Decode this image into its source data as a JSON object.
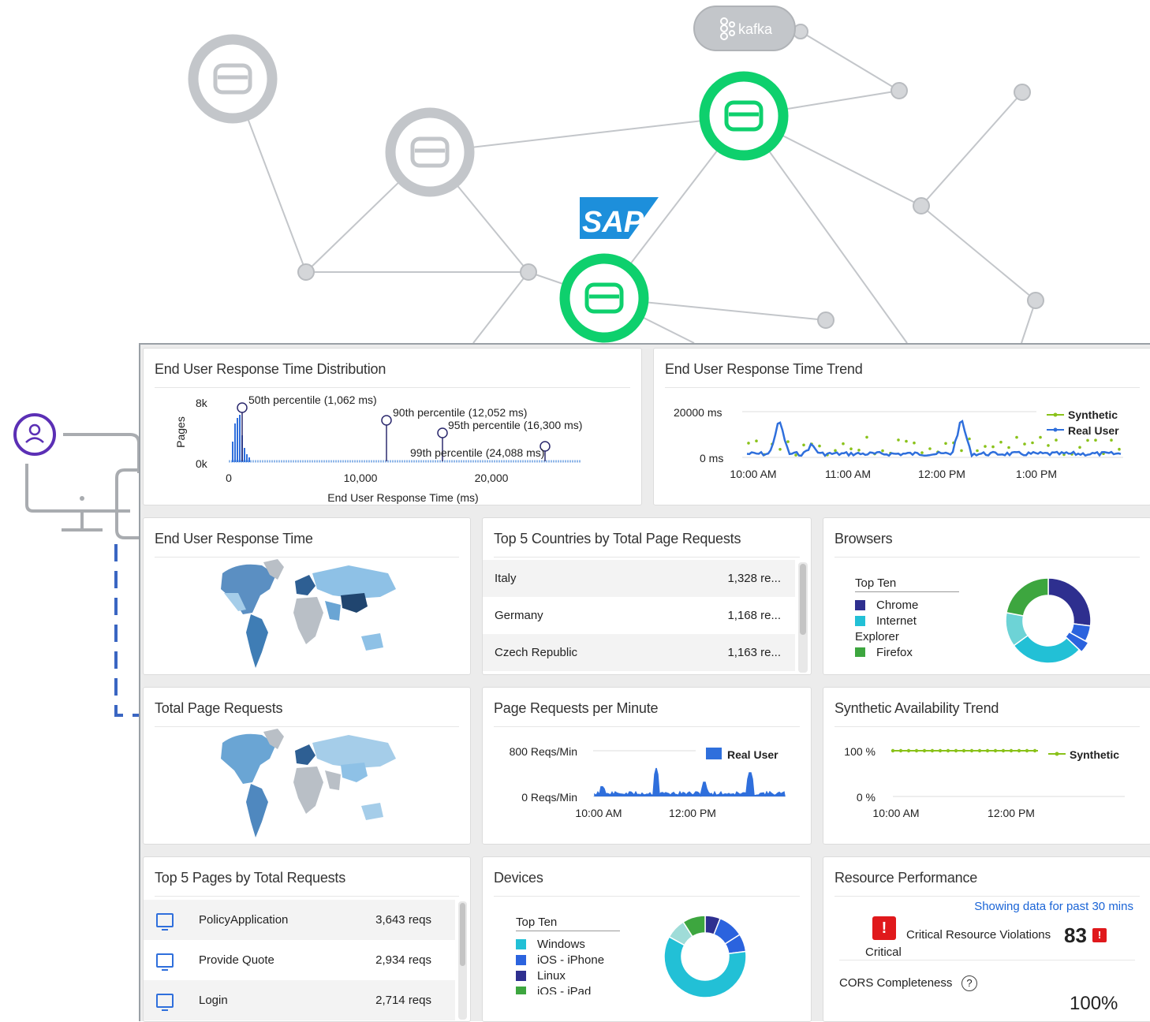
{
  "topology": {
    "kafka_label": "kafka",
    "sap_label": "SAP"
  },
  "panels": {
    "dist": {
      "title": "End User Response Time Distribution",
      "y_axis_label": "Pages",
      "y_ticks": [
        "8k",
        "0k"
      ],
      "x_ticks": [
        "0",
        "10,000",
        "20,000"
      ],
      "x_axis_label": "End User Response Time (ms)",
      "markers": [
        "50th percentile (1,062 ms)",
        "90th percentile (12,052 ms)",
        "95th percentile (16,300 ms)",
        "99th percentile (24,088 ms)"
      ]
    },
    "trend": {
      "title": "End User Response Time Trend",
      "y_ticks": [
        "20000 ms",
        "0 ms"
      ],
      "x_ticks": [
        "10:00 AM",
        "11:00 AM",
        "12:00 PM",
        "1:00 PM"
      ],
      "legend": [
        "Synthetic",
        "Real User"
      ]
    },
    "eurt_map": {
      "title": "End User Response Time"
    },
    "countries": {
      "title": "Top 5 Countries by Total Page Requests",
      "rows": [
        {
          "name": "Italy",
          "value": "1,328 re..."
        },
        {
          "name": "Germany",
          "value": "1,168 re..."
        },
        {
          "name": "Czech Republic",
          "value": "1,163 re..."
        }
      ]
    },
    "browsers": {
      "title": "Browsers",
      "legend_title": "Top Ten",
      "legend": [
        "Chrome",
        "Internet",
        "Explorer",
        "Firefox"
      ],
      "colors": [
        "#2e2f8f",
        "#22c0d6",
        "#2b63de",
        "#6dd3d6",
        "#3da63f"
      ]
    },
    "tpr_map": {
      "title": "Total Page Requests"
    },
    "ppm": {
      "title": "Page Requests per Minute",
      "y_ticks": [
        "800 Reqs/Min",
        "0 Reqs/Min"
      ],
      "x_ticks": [
        "10:00 AM",
        "12:00 PM"
      ],
      "legend": "Real User"
    },
    "avail": {
      "title": "Synthetic Availability Trend",
      "y_ticks": [
        "100 %",
        "0 %"
      ],
      "x_ticks": [
        "10:00 AM",
        "12:00 PM"
      ],
      "legend": "Synthetic"
    },
    "pages": {
      "title": "Top 5 Pages by Total Requests",
      "rows": [
        {
          "name": "PolicyApplication",
          "value": "3,643 reqs"
        },
        {
          "name": "Provide Quote",
          "value": "2,934 reqs"
        },
        {
          "name": "Login",
          "value": "2,714 reqs"
        }
      ]
    },
    "devices": {
      "title": "Devices",
      "legend_title": "Top Ten",
      "legend": [
        "Windows",
        "iOS - iPhone",
        "Linux",
        "iOS - iPad"
      ],
      "colors": [
        "#22c0d6",
        "#2b63de",
        "#2e2f8f",
        "#3da63f"
      ]
    },
    "resource": {
      "title": "Resource Performance",
      "note": "Showing data for past 30 mins",
      "violations_label": "Critical Resource Violations",
      "violations_count": "83",
      "critical_label": "Critical",
      "cors_label": "CORS Completeness",
      "cors_value": "100%"
    }
  }
}
